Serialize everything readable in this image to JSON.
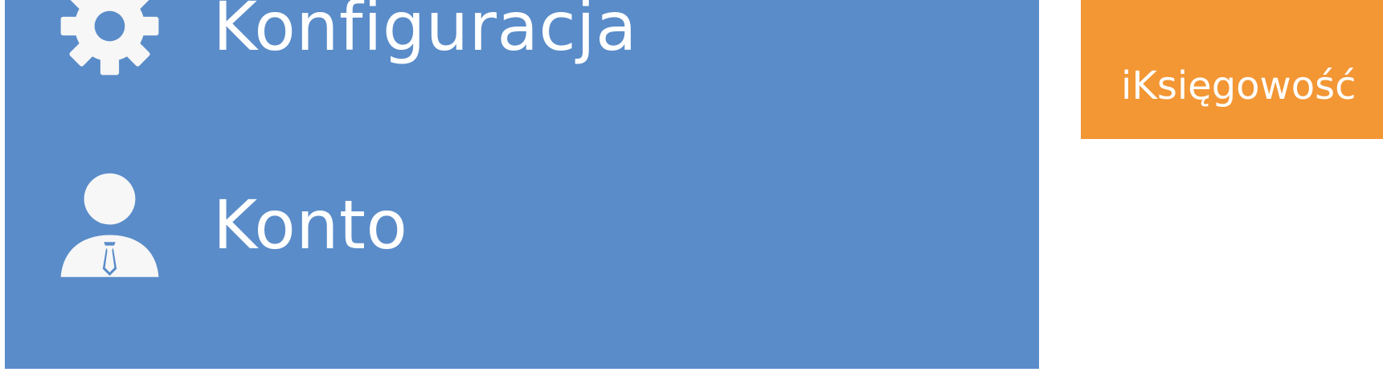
{
  "colors": {
    "sidebar_bg": "#5a8cc9",
    "tile_bg": "#f39634",
    "text": "#ffffff",
    "icon": "#f7f7f7"
  },
  "sidebar": {
    "items": [
      {
        "label": "Konfiguracja",
        "icon": "gear-icon"
      },
      {
        "label": "Konto",
        "icon": "user-icon"
      }
    ]
  },
  "tile": {
    "label": "iKsięgowość"
  }
}
